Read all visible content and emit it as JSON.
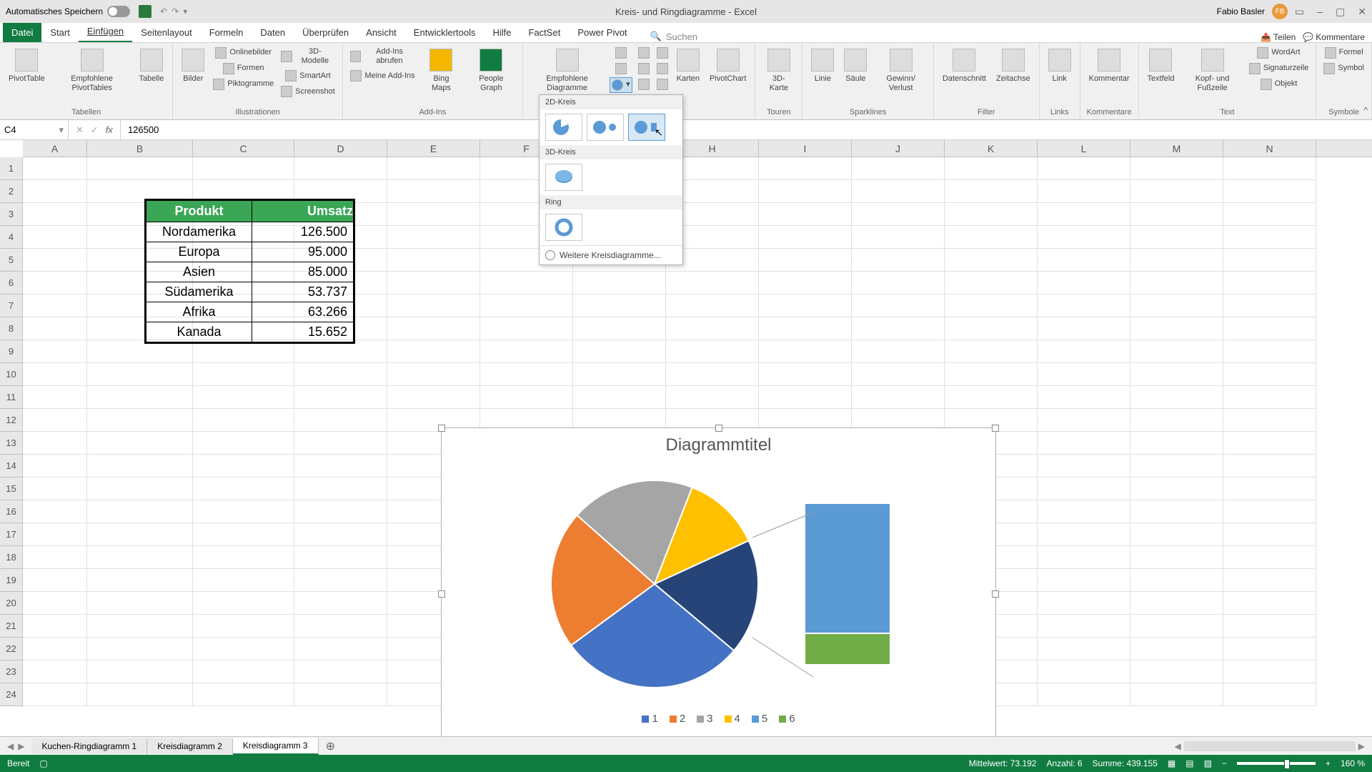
{
  "title_bar": {
    "autosave": "Automatisches Speichern",
    "doc_title": "Kreis- und Ringdiagramme - Excel",
    "user_name": "Fabio Basler",
    "user_initials": "FB"
  },
  "ribbon_tabs": {
    "file": "Datei",
    "tabs": [
      "Start",
      "Einfügen",
      "Seitenlayout",
      "Formeln",
      "Daten",
      "Überprüfen",
      "Ansicht",
      "Entwicklertools",
      "Hilfe",
      "FactSet",
      "Power Pivot"
    ],
    "active": "Einfügen",
    "search": "Suchen",
    "share": "Teilen",
    "comments": "Kommentare"
  },
  "ribbon": {
    "groups": {
      "tabellen": {
        "label": "Tabellen",
        "items": [
          "PivotTable",
          "Empfohlene PivotTables",
          "Tabelle"
        ]
      },
      "illustrationen": {
        "label": "Illustrationen",
        "bilder": "Bilder",
        "onlinebilder": "Onlinebilder",
        "formen": "Formen",
        "piktogramme": "Piktogramme",
        "models": "3D-Modelle",
        "smartart": "SmartArt",
        "screenshot": "Screenshot"
      },
      "addins": {
        "label": "Add-Ins",
        "abrufen": "Add-Ins abrufen",
        "meine": "Meine Add-Ins",
        "bing": "Bing Maps",
        "people": "People Graph"
      },
      "diagramme": {
        "label": "Diagramme",
        "empfohlene": "Empfohlene Diagramme",
        "karten": "Karten",
        "pivot": "PivotChart"
      },
      "touren": {
        "label": "Touren",
        "karte": "3D-Karte"
      },
      "sparklines": {
        "label": "Sparklines",
        "linie": "Linie",
        "saule": "Säule",
        "gewinn": "Gewinn/ Verlust"
      },
      "filter": {
        "label": "Filter",
        "datenschnitt": "Datenschnitt",
        "zeitachse": "Zeitachse"
      },
      "links": {
        "label": "Links",
        "link": "Link"
      },
      "kommentare": {
        "label": "Kommentare",
        "kommentar": "Kommentar"
      },
      "text": {
        "label": "Text",
        "textfeld": "Textfeld",
        "kopf": "Kopf- und Fußzeile",
        "wordart": "WordArt",
        "sig": "Signaturzeile",
        "objekt": "Objekt"
      },
      "symbole": {
        "label": "Symbole",
        "formel": "Formel",
        "symbol": "Symbol"
      }
    }
  },
  "chart_dropdown": {
    "section_2d": "2D-Kreis",
    "section_3d": "3D-Kreis",
    "section_ring": "Ring",
    "more": "Weitere Kreisdiagramme..."
  },
  "formula_bar": {
    "cell_ref": "C4",
    "value": "126500"
  },
  "columns": [
    "A",
    "B",
    "C",
    "D",
    "E",
    "F",
    "G",
    "H",
    "I",
    "J",
    "K",
    "L",
    "M",
    "N"
  ],
  "table": {
    "headers": [
      "Produkt",
      "Umsatz"
    ],
    "rows": [
      [
        "Nordamerika",
        "126.500"
      ],
      [
        "Europa",
        "95.000"
      ],
      [
        "Asien",
        "85.000"
      ],
      [
        "Südamerika",
        "53.737"
      ],
      [
        "Afrika",
        "63.266"
      ],
      [
        "Kanada",
        "15.652"
      ]
    ]
  },
  "chart_data": {
    "type": "pie",
    "title": "Diagrammtitel",
    "categories": [
      "Nordamerika",
      "Europa",
      "Asien",
      "Südamerika",
      "Afrika",
      "Kanada"
    ],
    "values": [
      126500,
      95000,
      85000,
      53737,
      63266,
      15652
    ],
    "legend_labels": [
      "1",
      "2",
      "3",
      "4",
      "5",
      "6"
    ],
    "colors": [
      "#4472c4",
      "#ed7d31",
      "#a5a5a5",
      "#ffc000",
      "#5b9bd5",
      "#70ad47"
    ],
    "secondary_bar": {
      "colors": [
        "#5b9bd5",
        "#70ad47"
      ],
      "heights": [
        182,
        44
      ]
    }
  },
  "sheet_tabs": {
    "tabs": [
      "Kuchen-Ringdiagramm 1",
      "Kreisdiagramm 2",
      "Kreisdiagramm 3"
    ],
    "active": "Kreisdiagramm 3"
  },
  "status_bar": {
    "ready": "Bereit",
    "mittelwert": "Mittelwert: 73.192",
    "anzahl": "Anzahl: 6",
    "summe": "Summe: 439.155",
    "zoom": "160 %"
  }
}
